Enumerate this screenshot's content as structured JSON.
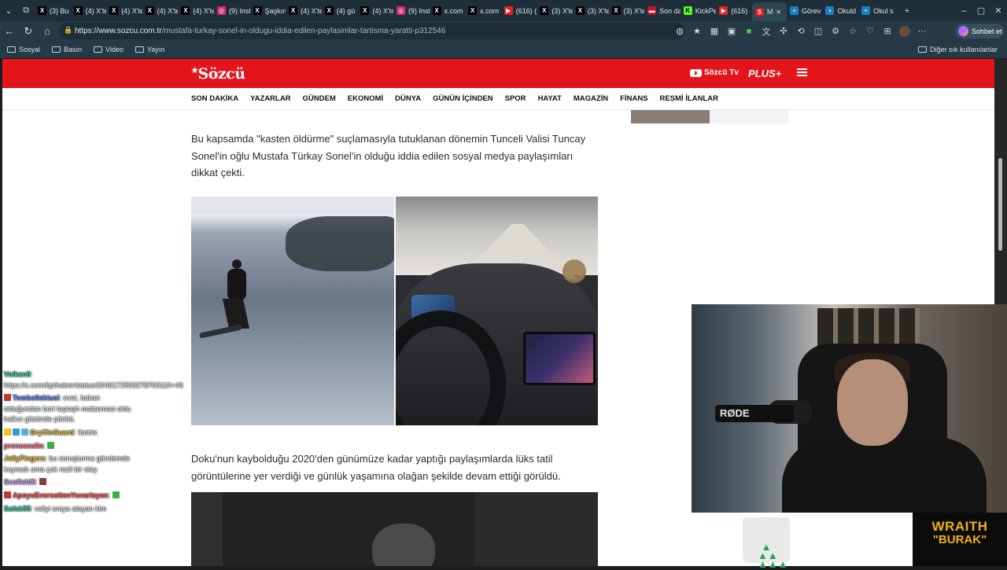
{
  "browser": {
    "tabs": [
      {
        "label": "(3) Bu",
        "icon": "x-icon"
      },
      {
        "label": "(4) X'te",
        "icon": "x-icon"
      },
      {
        "label": "(4) X'te",
        "icon": "x-icon"
      },
      {
        "label": "(4) X'te",
        "icon": "x-icon"
      },
      {
        "label": "(4) X'te",
        "icon": "x-icon"
      },
      {
        "label": "(9) Inst",
        "icon": "instagram-icon"
      },
      {
        "label": "Şaşkın",
        "icon": "x-icon"
      },
      {
        "label": "(4) X'te",
        "icon": "x-icon"
      },
      {
        "label": "(4) gü",
        "icon": "x-icon"
      },
      {
        "label": "(4) X'te",
        "icon": "x-icon"
      },
      {
        "label": "(9) Inst",
        "icon": "instagram-icon"
      },
      {
        "label": "x.com",
        "icon": "x-icon"
      },
      {
        "label": "x.com",
        "icon": "x-icon"
      },
      {
        "label": "(616) (",
        "icon": "youtube-icon"
      },
      {
        "label": "(3) X'te",
        "icon": "x-icon"
      },
      {
        "label": "(3) X'te",
        "icon": "x-icon"
      },
      {
        "label": "(3) X'te",
        "icon": "x-icon"
      },
      {
        "label": "Son da",
        "icon": "news-icon"
      },
      {
        "label": "KickPe",
        "icon": "kick-icon"
      },
      {
        "label": "(616)",
        "icon": "youtube-icon"
      },
      {
        "label": "M",
        "icon": "sozcu-icon",
        "active": true
      },
      {
        "label": "Görev",
        "icon": "site-icon"
      },
      {
        "label": "Okuld",
        "icon": "site-icon"
      },
      {
        "label": "Okul s",
        "icon": "site-icon"
      }
    ],
    "url_domain": "https://www.sozcu.com.tr",
    "url_path": "/mustafa-turkay-sonel-in-oldugu-iddia-edilen-paylasimlar-tartisma-yaratti-p312546",
    "chat_button": "Sohbet et",
    "bookmarks": [
      "Sosyal",
      "Basın",
      "Video",
      "Yayın"
    ],
    "other_bookmarks": "Diğer sık kullanılanlar"
  },
  "site": {
    "logo": "Sözcü",
    "tv_label": "Sözcü Tv",
    "plus_label": "PLUS+",
    "nav": [
      "SON DAKİKA",
      "YAZARLAR",
      "GÜNDEM",
      "EKONOMİ",
      "DÜNYA",
      "GÜNÜN İÇİNDEN",
      "SPOR",
      "HAYAT",
      "MAGAZİN",
      "FİNANS",
      "RESMİ İLANLAR"
    ]
  },
  "article": {
    "paragraph1": "Bu kapsamda \"kasten öldürme\" suçlamasıyla tutuklanan dönemin Tunceli Valisi Tuncay Sonel'in oğlu Mustafa Türkay Sonel'in olduğu iddia edilen sosyal medya paylaşımları dikkat çekti.",
    "paragraph2": "Doku'nun kaybolduğu 2020'den günümüze kadar yaptığı paylaşımlarda lüks tatil görüntülerine yer verdiği ve günlük yaşamına olağan şekilde devam ettiği görüldü."
  },
  "chat": [
    {
      "user": "Volkan8",
      "text": "https://x.com/bpthaber/status/2046172503278763110=46",
      "color": "#3fd0a8"
    },
    {
      "user": "Tembellektuel",
      "text": "evet, bakan olduğundan beri taştaşh malzemesi oldu halkın gözünde pünkü.",
      "color": "#6a8cff"
    },
    {
      "user": "GryffinGuard",
      "text": "!botrix",
      "color": "#e6c24a"
    },
    {
      "user": "preneseslin",
      "text": "",
      "color": "#ff7a9a"
    },
    {
      "user": "JellyFingers",
      "text": "bu soruşturma gündemde kaynadı ama çok rezil bir olay",
      "color": "#f0c040"
    },
    {
      "user": "Scofield8",
      "text": "",
      "color": "#d8a0ff"
    },
    {
      "user": "ApoyuEversettenYuvarlayan",
      "text": "",
      "color": "#ff5a5a"
    },
    {
      "user": "Safak55",
      "text": "valiyi oraya atayan kim",
      "color": "#3fd0a8"
    }
  ],
  "overlay": {
    "mic_brand": "RØDE",
    "brand_line1": "WRAITH",
    "brand_line2": "\"BURAK\""
  }
}
